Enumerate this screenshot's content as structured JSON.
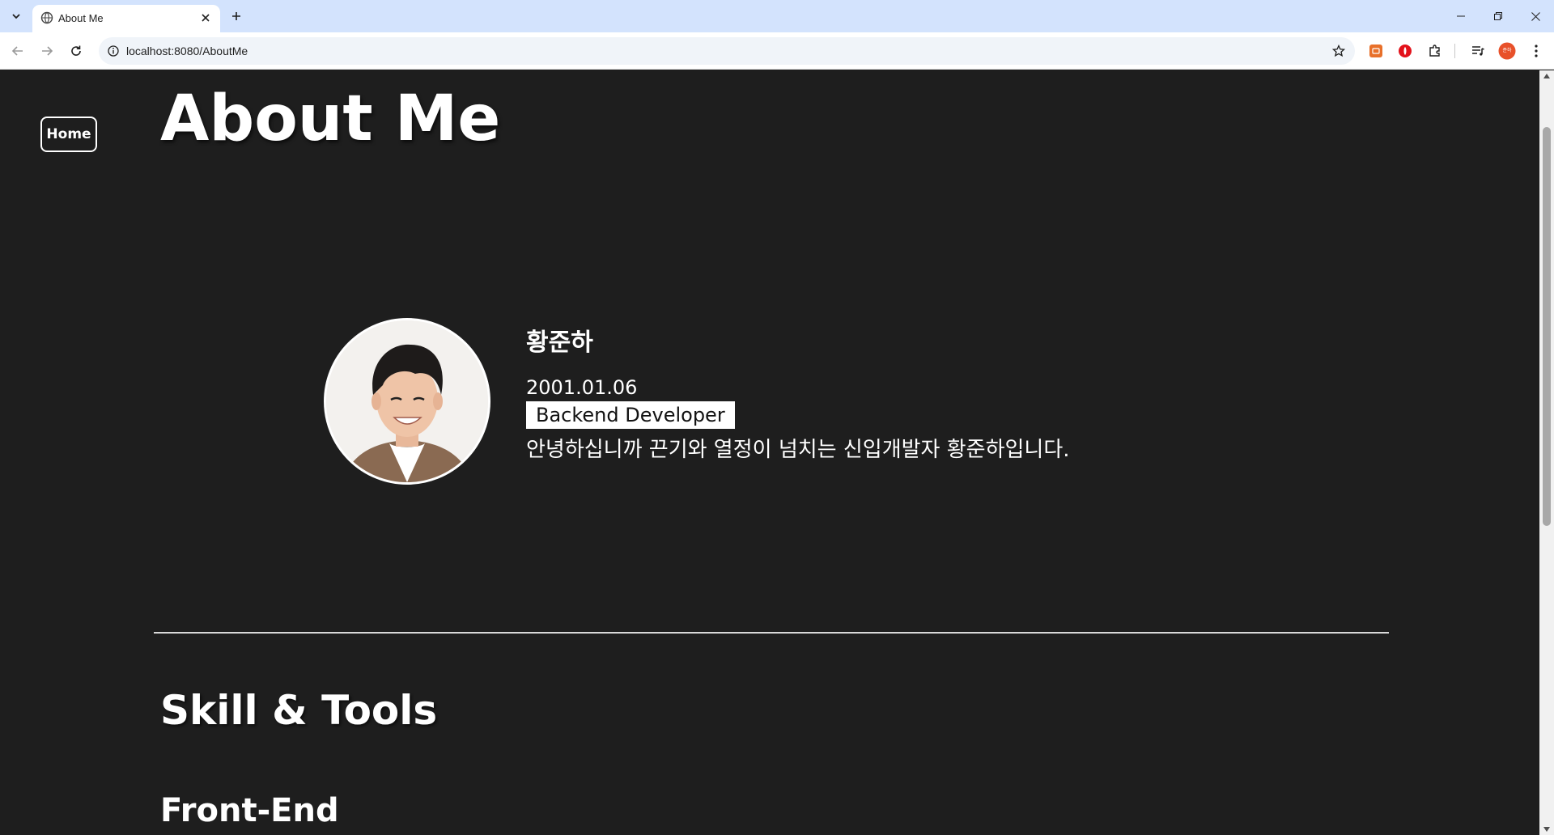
{
  "browser": {
    "tab_title": "About Me",
    "url": "localhost:8080/AboutMe",
    "profile_initials": "준하"
  },
  "page": {
    "home_label": "Home",
    "title": "About Me"
  },
  "profile": {
    "name": "황준하",
    "birth": "2001.01.06",
    "role": "Backend Developer",
    "intro": "안녕하십니까 끈기와 열정이 넘치는 신입개발자 황준하입니다."
  },
  "skills": {
    "section_title": "Skill & Tools",
    "subsections": [
      {
        "title": "Front-End"
      }
    ]
  },
  "colors": {
    "background": "#1e1e1e",
    "text": "#ffffff",
    "tabstrip": "#d3e3fd",
    "badge_bg": "#ffffff"
  }
}
